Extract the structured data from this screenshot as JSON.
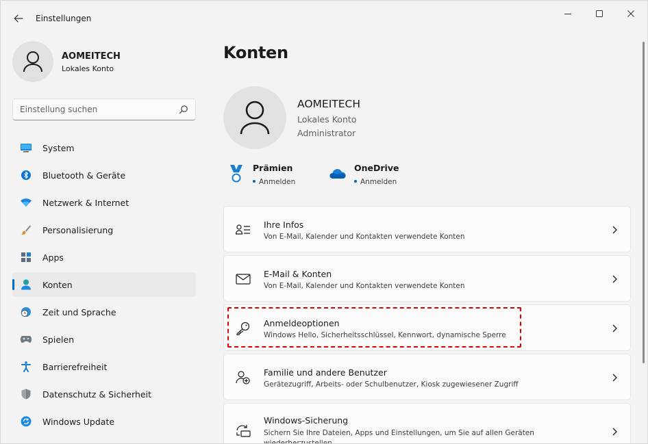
{
  "window": {
    "title": "Einstellungen",
    "icons": {
      "back": "back-arrow-icon",
      "minimize": "minimize-icon",
      "maximize": "maximize-icon",
      "close": "close-icon"
    }
  },
  "sidebar": {
    "profile": {
      "name": "AOMEITECH",
      "type": "Lokales Konto"
    },
    "search": {
      "placeholder": "Einstellung suchen",
      "value": ""
    },
    "items": [
      {
        "label": "System",
        "icon": "monitor-icon",
        "active": false
      },
      {
        "label": "Bluetooth & Geräte",
        "icon": "bluetooth-icon",
        "active": false
      },
      {
        "label": "Netzwerk & Internet",
        "icon": "wifi-icon",
        "active": false
      },
      {
        "label": "Personalisierung",
        "icon": "paintbrush-icon",
        "active": false
      },
      {
        "label": "Apps",
        "icon": "apps-icon",
        "active": false
      },
      {
        "label": "Konten",
        "icon": "person-icon",
        "active": true
      },
      {
        "label": "Zeit und Sprache",
        "icon": "globe-clock-icon",
        "active": false
      },
      {
        "label": "Spielen",
        "icon": "gamepad-icon",
        "active": false
      },
      {
        "label": "Barrierefreiheit",
        "icon": "accessibility-icon",
        "active": false
      },
      {
        "label": "Datenschutz & Sicherheit",
        "icon": "shield-icon",
        "active": false
      },
      {
        "label": "Windows Update",
        "icon": "update-icon",
        "active": false
      }
    ]
  },
  "main": {
    "title": "Konten",
    "account": {
      "name": "AOMEITECH",
      "type": "Lokales Konto",
      "role": "Administrator"
    },
    "services": [
      {
        "title": "Prämien",
        "status": "Anmelden",
        "icon": "medal-icon"
      },
      {
        "title": "OneDrive",
        "status": "Anmelden",
        "icon": "cloud-icon"
      }
    ],
    "cards": [
      {
        "title": "Ihre Infos",
        "subtitle": "Von E-Mail, Kalender und Kontakten verwendete Konten",
        "icon": "person-list-icon"
      },
      {
        "title": "E-Mail & Konten",
        "subtitle": "Von E-Mail, Kalender und Kontakten verwendete Konten",
        "icon": "mail-icon"
      },
      {
        "title": "Anmeldeoptionen",
        "subtitle": "Windows Hello, Sicherheitsschlüssel, Kennwort, dynamische Sperre",
        "icon": "key-icon"
      },
      {
        "title": "Familie und andere Benutzer",
        "subtitle": "Gerätezugriff, Arbeits- oder Schulbenutzer, Kiosk zugewiesener Zugriff",
        "icon": "person-add-icon"
      },
      {
        "title": "Windows-Sicherung",
        "subtitle": "Sichern Sie Ihre Dateien, Apps und Einstellungen, um Sie auf allen Geräten wiederherzustellen",
        "icon": "backup-icon"
      }
    ]
  },
  "colors": {
    "accent": "#0067c0",
    "highlight": "#e00000",
    "background": "#f3f3f3",
    "card": "#fbfbfb"
  }
}
